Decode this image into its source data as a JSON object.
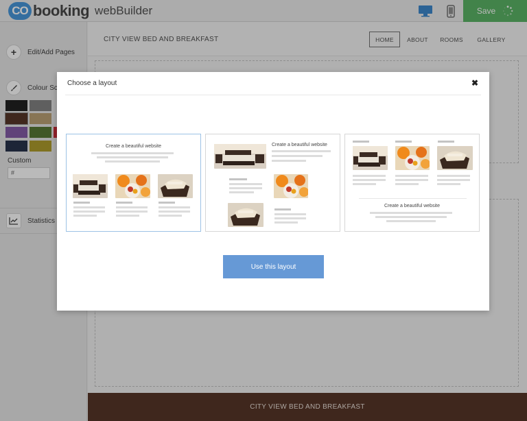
{
  "app": {
    "logo_mark": "CO",
    "logo_name": "booking",
    "logo_suffix": "webBuilder",
    "save_label": "Save",
    "desktop_icon": "monitor-icon",
    "mobile_icon": "phone-icon",
    "accent": "#3a8fd8",
    "save_color": "#4fae5a"
  },
  "sidebar": {
    "edit_pages_label": "Edit/Add Pages",
    "colour_scheme_label": "Colour Sch",
    "custom_label": "Custom",
    "custom_value": "#",
    "statistics_label": "Statistics",
    "swatches": [
      "#111111",
      "#7a7a7a",
      "#4a2718",
      "#b59a6a",
      "#7b4ea0",
      "#4b6e26",
      "#18243f",
      "#a8961c",
      "#c4202c"
    ]
  },
  "site": {
    "title": "CITY VIEW BED AND BREAKFAST",
    "nav": [
      "HOME",
      "ABOUT",
      "ROOMS",
      "GALLERY"
    ],
    "footer_text": "CITY VIEW BED AND BREAKFAST",
    "footer_color": "#4a2718"
  },
  "modal": {
    "title": "Choose a layout",
    "close_icon": "close-icon",
    "layouts": [
      {
        "caption": "Create a beautiful website"
      },
      {
        "caption": "Create a beautiful website"
      },
      {
        "caption": "Create a beautiful website"
      }
    ],
    "button_label": "Use this layout",
    "button_color": "#6699d6"
  }
}
